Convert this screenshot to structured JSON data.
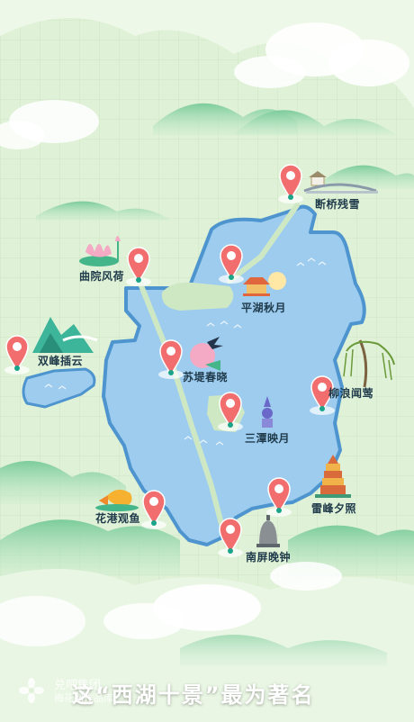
{
  "colors": {
    "background": "#dff1d6",
    "lake": "#9dccef",
    "lake_edge": "#4e95cf",
    "causeway": "#cfe8c4",
    "pin": "#f26e6e",
    "pin_dot": "#1aa58a",
    "label_text": "#1f3a4a"
  },
  "spots": [
    {
      "id": "duanqiao",
      "label": "断桥残雪",
      "icon": "broken-bridge-icon"
    },
    {
      "id": "quyuan",
      "label": "曲院风荷",
      "icon": "lotus-icon"
    },
    {
      "id": "pinghu",
      "label": "平湖秋月",
      "icon": "pavilion-icon"
    },
    {
      "id": "shuangfeng",
      "label": "双峰插云",
      "icon": "twin-peaks-icon"
    },
    {
      "id": "sudi",
      "label": "苏堤春晓",
      "icon": "swallow-icon"
    },
    {
      "id": "liulang",
      "label": "柳浪闻莺",
      "icon": "willow-icon"
    },
    {
      "id": "santan",
      "label": "三潭映月",
      "icon": "stone-pagoda-icon"
    },
    {
      "id": "leifeng",
      "label": "雷峰夕照",
      "icon": "leifeng-pagoda-icon"
    },
    {
      "id": "huagang",
      "label": "花港观鱼",
      "icon": "goldfish-icon"
    },
    {
      "id": "nanping",
      "label": "南屏晚钟",
      "icon": "bell-icon"
    }
  ],
  "caption": "这“西湖十景”最为著名",
  "watermark": {
    "line1": "兑吧集团",
    "line2": "梅花网作品库",
    "icon": "flower-logo-icon"
  }
}
